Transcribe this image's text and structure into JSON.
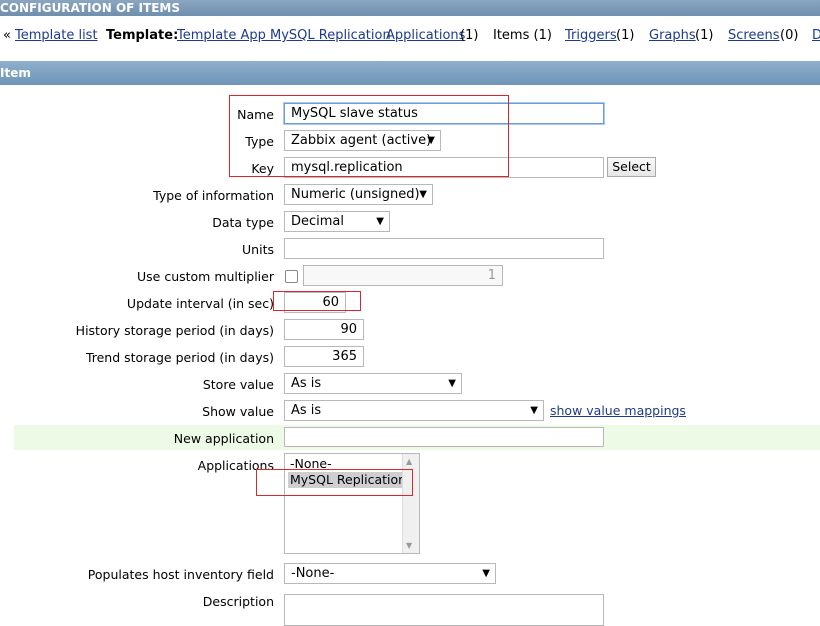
{
  "header": {
    "title": "CONFIGURATION OF ITEMS"
  },
  "breadcrumb": {
    "back_prefix": "«",
    "template_list": "Template list",
    "template_label": "Template:",
    "template_name": "Template App MySQL Replication",
    "applications": "Applications",
    "applications_count": "(1)",
    "items": "Items (1)",
    "triggers": "Triggers",
    "triggers_count": "(1)",
    "graphs": "Graphs",
    "graphs_count": "(1)",
    "screens": "Screens",
    "screens_count": "(0)",
    "next_cut": "D"
  },
  "section": {
    "title": "Item"
  },
  "form": {
    "name_label": "Name",
    "name_value": "MySQL slave status",
    "type_label": "Type",
    "type_value": "Zabbix agent (active)",
    "key_label": "Key",
    "key_value": "mysql.replication",
    "select_button": "Select",
    "type_info_label": "Type of information",
    "type_info_value": "Numeric (unsigned)",
    "data_type_label": "Data type",
    "data_type_value": "Decimal",
    "units_label": "Units",
    "units_value": "",
    "multiplier_label": "Use custom multiplier",
    "multiplier_value": "1",
    "update_label": "Update interval (in sec)",
    "update_value": "60",
    "history_label": "History storage period (in days)",
    "history_value": "90",
    "trend_label": "Trend storage period (in days)",
    "trend_value": "365",
    "store_label": "Store value",
    "store_value": "As is",
    "show_label": "Show value",
    "show_value": "As is",
    "show_mappings_link": "show value mappings",
    "new_app_label": "New application",
    "new_app_value": "",
    "applications_label": "Applications",
    "applications_options": [
      "-None-",
      "MySQL Replication"
    ],
    "inventory_label": "Populates host inventory field",
    "inventory_value": "-None-",
    "description_label": "Description"
  },
  "colors": {
    "accent_red": "#d9272e",
    "header_blue": "#7b9bb9",
    "link_blue": "#1e3a8a",
    "new_app_row": "#edfae6"
  }
}
